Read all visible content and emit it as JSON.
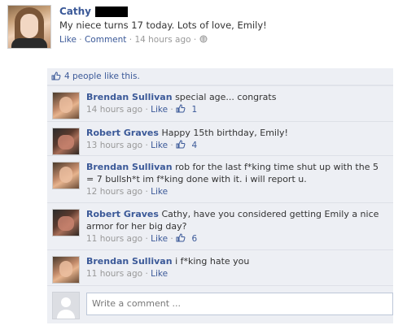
{
  "post": {
    "author": "Cathy",
    "text": "My niece turns 17 today. Lots of love, Emily!",
    "like_label": "Like",
    "comment_label": "Comment",
    "time": "14 hours ago"
  },
  "feedback": {
    "likes_text": "4 people like this.",
    "comments": [
      {
        "author": "Brendan Sullivan",
        "text": "special age... congrats",
        "time": "14 hours ago",
        "like_label": "Like",
        "likes": "1"
      },
      {
        "author": "Robert Graves",
        "text": "Happy 15th birthday, Emily!",
        "time": "13 hours ago",
        "like_label": "Like",
        "likes": "4"
      },
      {
        "author": "Brendan Sullivan",
        "text": "rob for the last f*king time shut up with the 5 = 7 bullsh*t im f*king done with it. i will report u.",
        "time": "12 hours ago",
        "like_label": "Like",
        "likes": ""
      },
      {
        "author": "Robert Graves",
        "text": "Cathy, have you considered getting Emily a nice armor for her big day?",
        "time": "11 hours ago",
        "like_label": "Like",
        "likes": "6"
      },
      {
        "author": "Brendan Sullivan",
        "text": "i f*king hate you",
        "time": "11 hours ago",
        "like_label": "Like",
        "likes": ""
      }
    ],
    "write_placeholder": "Write a comment ..."
  },
  "colors": {
    "link": "#3b5998",
    "panel": "#edeff4",
    "meta": "#999999"
  },
  "icons": [
    "thumbs-up-icon",
    "globe-icon"
  ]
}
